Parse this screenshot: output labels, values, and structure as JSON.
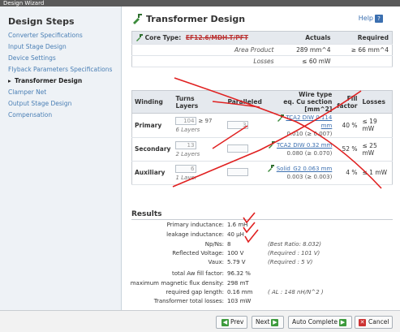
{
  "window": {
    "title": "Design Wizard"
  },
  "sidebar": {
    "title": "Design Steps",
    "items": [
      {
        "label": "Converter Specifications",
        "active": false
      },
      {
        "label": "Input Stage Design",
        "active": false
      },
      {
        "label": "Device Settings",
        "active": false
      },
      {
        "label": "Flyback Parameters Specifications",
        "active": false
      },
      {
        "label": "Transformer Design",
        "active": true,
        "marker": "▸"
      },
      {
        "label": "Clamper Net",
        "active": false
      },
      {
        "label": "Output Stage Design",
        "active": false
      },
      {
        "label": "Compensation",
        "active": false
      }
    ]
  },
  "page": {
    "title": "Transformer Design",
    "help_label": "Help",
    "help_badge": "?"
  },
  "core": {
    "label": "Core Type:",
    "value": "EF12.6/MDH-T/PFT",
    "col_actuals": "Actuals",
    "col_required": "Required",
    "rows": [
      {
        "label": "Area Product",
        "actual": "289 mm^4",
        "required": "≥ 66 mm^4"
      },
      {
        "label": "Losses",
        "actual": "≤ 60 mW",
        "required": ""
      }
    ]
  },
  "windings": {
    "headers": {
      "winding": "Winding",
      "turns": "Turns",
      "layers": "Layers",
      "paralleled": "Paralleled",
      "wire": "Wire type",
      "wire_sub": "eq. Cu section [mm^2]",
      "fill": "Fill factor",
      "losses": "Losses"
    },
    "rows": [
      {
        "name": "Primary",
        "turns": "104",
        "turns_req": "≥ 97",
        "layers": "6 Layers",
        "paralleled": "3",
        "wire": "TCA2 DIW 0.114 mm",
        "section": "0.010 (≥ 0.007)",
        "fill": "40 %",
        "losses": "≤ 19 mW"
      },
      {
        "name": "Secondary",
        "turns": "13",
        "turns_req": "",
        "layers": "2 Layers",
        "paralleled": "",
        "wire": "TCA2 DIW 0.32 mm",
        "section": "0.080 (≥ 0.070)",
        "fill": "52 %",
        "losses": "≤ 25 mW"
      },
      {
        "name": "Auxiliary",
        "turns": "6",
        "turns_req": "",
        "layers": "1 Layer",
        "paralleled": "",
        "wire": "Solid_G2 0.063 mm",
        "section": "0.003 (≥ 0.003)",
        "fill": "4 %",
        "losses": "≤ 1 mW"
      }
    ]
  },
  "results": {
    "title": "Results",
    "rows": [
      {
        "label": "Primary inductance:",
        "value": "1.6 mH",
        "note": ""
      },
      {
        "label": "leakage inductance:",
        "value": "40 µH",
        "note": ""
      },
      {
        "label": "Np/Ns:",
        "value": "8",
        "note": "(Best Ratio: 8.032)"
      },
      {
        "label": "Reflected Voltage:",
        "value": "100 V",
        "note": "(Required : 101 V)"
      },
      {
        "label": "Vaux:",
        "value": "5.79 V",
        "note": "(Required : 5 V)"
      },
      {
        "label": "total Aw fill factor:",
        "value": "96.32 %",
        "note": ""
      },
      {
        "label": "maximum magnetic flux density:",
        "value": "298 mT",
        "note": ""
      },
      {
        "label": "required gap length:",
        "value": "0.16 mm",
        "note": "( AL : 148 nH/N^2 )"
      },
      {
        "label": "Transformer total losses:",
        "value": "103 mW",
        "note": ""
      }
    ]
  },
  "footer": {
    "prev": "Prev",
    "next": "Next",
    "auto": "Auto Complete",
    "cancel": "Cancel"
  },
  "colors": {
    "accent": "#3b6fb0",
    "annotation": "#e02020",
    "confirm": "#3c9a3c"
  }
}
